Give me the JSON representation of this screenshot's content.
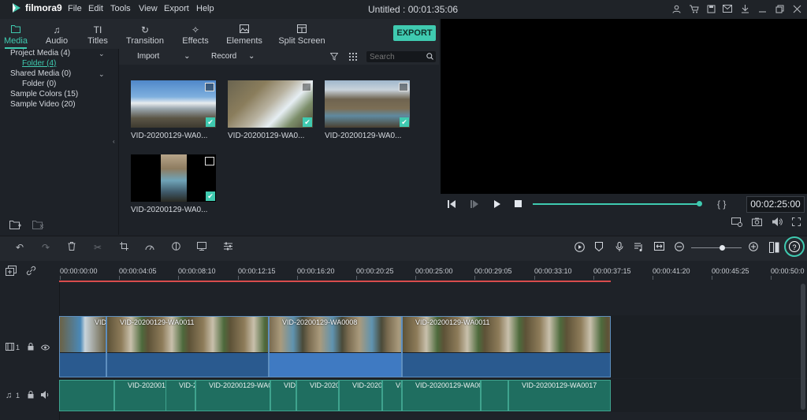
{
  "app": {
    "name": "filmora9",
    "doc_title": "Untitled : 00:01:35:06"
  },
  "menu": [
    "File",
    "Edit",
    "Tools",
    "View",
    "Export",
    "Help"
  ],
  "title_icons": [
    "user-icon",
    "cart-icon",
    "save-icon",
    "mail-icon",
    "minimize-icon",
    "restore-icon",
    "close-icon"
  ],
  "nav": {
    "tabs": [
      "Media",
      "Audio",
      "Titles",
      "Transition",
      "Effects",
      "Elements",
      "Split Screen"
    ],
    "active": "Media",
    "export_label": "EXPORT"
  },
  "tree": {
    "items": [
      "Project Media (4)",
      "Folder (4)",
      "Shared Media (0)",
      "Folder (0)",
      "Sample Colors (15)",
      "Sample Video (20)"
    ]
  },
  "media_bar": {
    "import_label": "Import",
    "record_label": "Record",
    "search_placeholder": "Search"
  },
  "media": {
    "items": [
      {
        "label": "VID-20200129-WA0..."
      },
      {
        "label": "VID-20200129-WA0..."
      },
      {
        "label": "VID-20200129-WA0..."
      },
      {
        "label": "VID-20200129-WA0..."
      }
    ]
  },
  "player": {
    "timecode": "00:02:25:00",
    "progress": 0.98,
    "brackets": "{ }"
  },
  "ruler": {
    "ticks": [
      "00:00:00:00",
      "00:00:04:05",
      "00:00:08:10",
      "00:00:12:15",
      "00:00:16:20",
      "00:00:20:25",
      "00:00:25:00",
      "00:00:29:05",
      "00:00:33:10",
      "00:00:37:15",
      "00:00:41:20",
      "00:00:45:25",
      "00:00:50:0"
    ]
  },
  "tracks": {
    "video_label": "1",
    "audio_label": "1",
    "video_clips": [
      "VID",
      "VID-20200129-WA0011",
      "VID-20200129-WA0008",
      "VID-20200129-WA0011"
    ],
    "audio_clips": [
      "VID-2020012",
      "VID-2",
      "VID-20200129-WA00",
      "VID-",
      "VID-2020",
      "VID-2020",
      "VI",
      "VID-20200129-WA001",
      "VID-20200129-WA0017"
    ]
  },
  "colors": {
    "accent": "#3fcab0",
    "playhead": "#d94c4c",
    "video_wave": "#2a5a8f",
    "audio_clip": "#1f6e60"
  }
}
